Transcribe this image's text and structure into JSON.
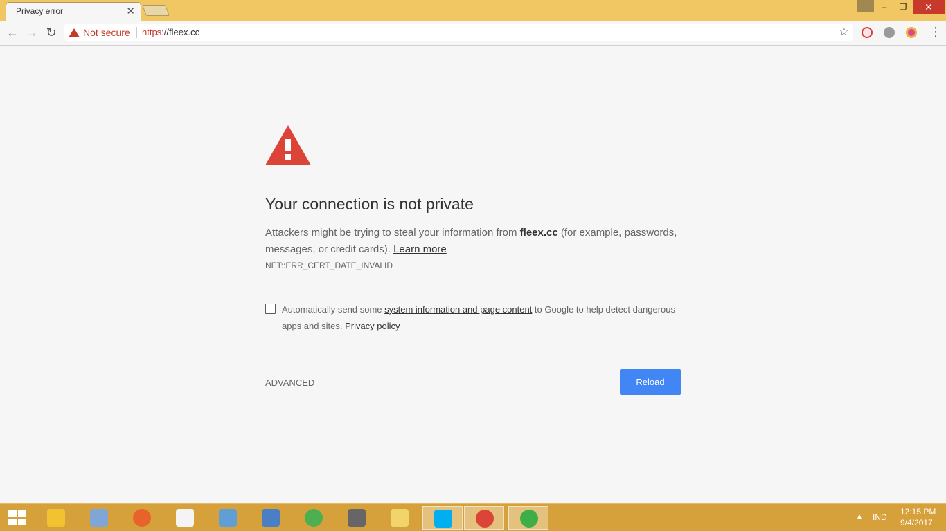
{
  "tab": {
    "title": "Privacy error",
    "close_glyph": "✕"
  },
  "window_controls": {
    "minimize": "–",
    "maximize": "❐",
    "close": "✕"
  },
  "toolbar": {
    "security_label": "Not secure",
    "url_scheme": "https",
    "url_rest": "://fleex.cc",
    "back_glyph": "←",
    "forward_glyph": "→",
    "reload_glyph": "↻",
    "star_glyph": "☆",
    "menu_glyph": "⋮",
    "extensions": [
      "adblock-extension-icon",
      "cloud-extension-icon",
      "color-extension-icon"
    ]
  },
  "interstitial": {
    "headline": "Your connection is not private",
    "explain_pre": "Attackers might be trying to steal your information from ",
    "explain_host": "fleex.cc",
    "explain_post": " (for example, passwords, messages, or credit cards). ",
    "learn_more": "Learn more",
    "error_code": "NET::ERR_CERT_DATE_INVALID",
    "optin_pre": "Automatically send some ",
    "optin_link": "system information and page content",
    "optin_mid": " to Google to help detect dangerous apps and sites. ",
    "privacy_policy": "Privacy policy",
    "optin_checked": false,
    "advanced": "ADVANCED",
    "reload": "Reload"
  },
  "taskbar": {
    "items": [
      {
        "name": "rocket-app-icon",
        "color": "#f2c230",
        "active": false
      },
      {
        "name": "paint-app-icon",
        "color": "#7fa6d6",
        "active": false
      },
      {
        "name": "firefox-icon",
        "color": "#e8632b",
        "active": false
      },
      {
        "name": "media-player-icon",
        "color": "#f4f4f4",
        "active": false
      },
      {
        "name": "photo-viewer-icon",
        "color": "#5f9fd6",
        "active": false
      },
      {
        "name": "keyboard-app-icon",
        "color": "#4a7fc6",
        "active": false
      },
      {
        "name": "chrome-icon",
        "color": "#4caf50",
        "active": false
      },
      {
        "name": "ccleaner-icon",
        "color": "#666666",
        "active": false
      },
      {
        "name": "file-explorer-icon",
        "color": "#f3d36b",
        "active": false
      },
      {
        "name": "skype-icon",
        "color": "#00aff0",
        "active": true
      },
      {
        "name": "chrome-running-icon",
        "color": "#db4437",
        "active": true
      },
      {
        "name": "download-manager-icon",
        "color": "#3fae49",
        "active": true
      }
    ],
    "tray": {
      "arrow": "▲",
      "language": "IND",
      "time": "12:15 PM",
      "date": "9/4/2017"
    }
  }
}
